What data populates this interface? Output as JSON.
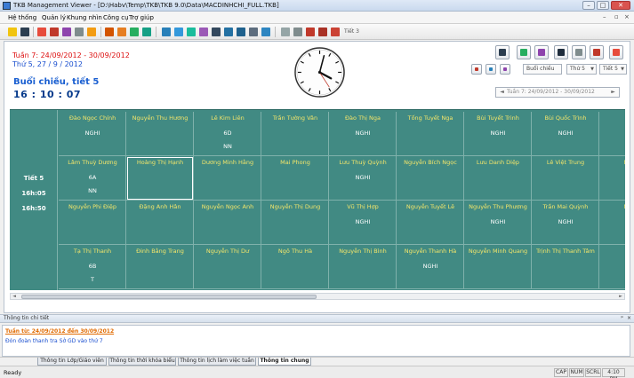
{
  "window": {
    "title": "TKB Management Viewer - [D:\\Habv\\Temp\\TKB\\TKB 9.0\\Data\\MACDINHCHI_FULL.TKB]"
  },
  "menu": [
    "Hệ thống",
    "Quản lý",
    "Khung nhìn",
    "Công cụ",
    "Trợ giúp"
  ],
  "toolbar": {
    "period_label": "Tiết 3"
  },
  "header": {
    "week": "Tuần 7: 24/09/2012 - 30/09/2012",
    "date": "Thứ 5, 27 / 9 / 2012",
    "session": "Buổi chiều, tiết 5",
    "time": "16 : 10 : 07"
  },
  "controls": {
    "session_btn": "Buổi chiều",
    "day_select": "Thứ 5",
    "period_select": "Tiết 5",
    "week_select": "Tuần 7: 24/09/2012 - 30/09/2012"
  },
  "grid": {
    "row_header": {
      "period": "Tiết 5",
      "start": "16h:05",
      "end": "16h:50"
    },
    "rows": [
      [
        {
          "name": "Đào Ngọc Chính",
          "l2": "NGHI",
          "l3": ""
        },
        {
          "name": "Nguyễn Thu Hương",
          "l2": "",
          "l3": ""
        },
        {
          "name": "Lê Kim Liên",
          "l2": "6D",
          "l3": "NN"
        },
        {
          "name": "Trần Tường Vân",
          "l2": "",
          "l3": ""
        },
        {
          "name": "Đào Thị Nga",
          "l2": "NGHI",
          "l3": ""
        },
        {
          "name": "Tống Tuyết Nga",
          "l2": "",
          "l3": ""
        },
        {
          "name": "Bùi Tuyết Trinh",
          "l2": "NGHI",
          "l3": ""
        },
        {
          "name": "Bùi Quốc Trình",
          "l2": "NGHI",
          "l3": ""
        },
        {
          "name": "Bùi",
          "l2": "",
          "l3": ""
        }
      ],
      [
        {
          "name": "Lâm Thuỳ Dương",
          "l2": "6A",
          "l3": "NN"
        },
        {
          "name": "Hoàng Thị Hạnh",
          "l2": "",
          "l3": ""
        },
        {
          "name": "Dương Minh Hằng",
          "l2": "",
          "l3": ""
        },
        {
          "name": "Mai Phong",
          "l2": "",
          "l3": ""
        },
        {
          "name": "Lưu Thuỳ Quỳnh",
          "l2": "NGHI",
          "l3": ""
        },
        {
          "name": "Nguyễn Bích Ngọc",
          "l2": "",
          "l3": ""
        },
        {
          "name": "Lưu Danh Diệp",
          "l2": "",
          "l3": ""
        },
        {
          "name": "Lê Việt Trung",
          "l2": "",
          "l3": ""
        },
        {
          "name": "Nguyễ",
          "l2": "",
          "l3": ""
        }
      ],
      [
        {
          "name": "Nguyễn Phi Điệp",
          "l2": "",
          "l3": ""
        },
        {
          "name": "Đặng Anh Hân",
          "l2": "",
          "l3": ""
        },
        {
          "name": "Nguyễn Ngọc Anh",
          "l2": "",
          "l3": ""
        },
        {
          "name": "Nguyễn Thị Dung",
          "l2": "",
          "l3": ""
        },
        {
          "name": "Vũ Thị Hợp",
          "l2": "NGHI",
          "l3": ""
        },
        {
          "name": "Nguyễn Tuyết Lê",
          "l2": "",
          "l3": ""
        },
        {
          "name": "Nguyễn Thu Phương",
          "l2": "NGHI",
          "l3": ""
        },
        {
          "name": "Trần Mai Quỳnh",
          "l2": "NGHI",
          "l3": ""
        },
        {
          "name": "Nguyễ",
          "l2": "",
          "l3": ""
        }
      ],
      [
        {
          "name": "Tạ Thị Thanh",
          "l2": "6B",
          "l3": "T"
        },
        {
          "name": "Đinh Bằng Trang",
          "l2": "",
          "l3": ""
        },
        {
          "name": "Nguyễn Thị Dư",
          "l2": "",
          "l3": ""
        },
        {
          "name": "Ngô Thu Hà",
          "l2": "",
          "l3": ""
        },
        {
          "name": "Nguyễn Thị Bình",
          "l2": "",
          "l3": ""
        },
        {
          "name": "Nguyễn Thanh Hà",
          "l2": "NGHI",
          "l3": ""
        },
        {
          "name": "Nguyễn Minh Quang",
          "l2": "",
          "l3": ""
        },
        {
          "name": "Trịnh Thị Thanh Tâm",
          "l2": "",
          "l3": ""
        },
        {
          "name": "Đoà",
          "l2": "",
          "l3": ""
        }
      ]
    ]
  },
  "detail": {
    "title": "Thông tin chi tiết",
    "line1": "Tuần từ: 24/09/2012 đến 30/09/2012",
    "line2": "Đón đoàn thanh tra Sở GD vào thứ 7"
  },
  "tabs": [
    "Thông tin Lớp/Giáo viên",
    "Thông tin thời khóa biểu",
    "Thông tin lịch làm việc tuần",
    "Thông tin chung"
  ],
  "status": {
    "ready": "Ready",
    "cap": "CAP",
    "num": "NUM",
    "scrl": "SCRL",
    "time": "4:10 PM"
  }
}
